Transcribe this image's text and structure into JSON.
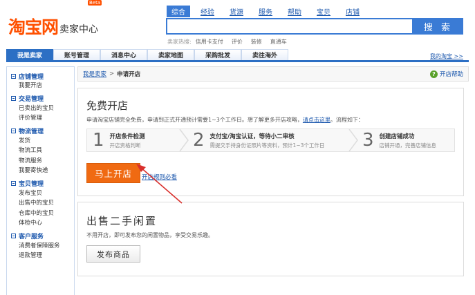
{
  "header": {
    "logo_main": "淘宝网",
    "logo_sub": "卖家中心",
    "logo_badge": "Beta",
    "search_tabs": [
      "综合",
      "经验",
      "货源",
      "服务",
      "帮助",
      "宝贝",
      "店铺"
    ],
    "search_button": "搜 索",
    "hot_label": "卖家热搜:",
    "hot_items": [
      "信用卡支付",
      "评价",
      "装修",
      "直通车"
    ]
  },
  "nav": {
    "items": [
      "我是卖家",
      "账号管理",
      "消息中心",
      "卖家地图",
      "采购批发",
      "卖往海外"
    ],
    "right_link": "我的淘宝 >>"
  },
  "sidebar": {
    "groups": [
      {
        "title": "店铺管理",
        "items": [
          "我要开店"
        ]
      },
      {
        "title": "交易管理",
        "items": [
          "已卖出的宝贝",
          "评价管理"
        ]
      },
      {
        "title": "物流管理",
        "items": [
          "发货",
          "物流工具",
          "物流服务",
          "我要寄快递"
        ]
      },
      {
        "title": "宝贝管理",
        "items": [
          "发布宝贝",
          "出售中的宝贝",
          "仓库中的宝贝",
          "体检中心"
        ]
      },
      {
        "title": "客户服务",
        "items": [
          "消费者保障服务",
          "退款管理"
        ]
      }
    ]
  },
  "breadcrumb": {
    "root": "我是卖家",
    "sep": ">",
    "current": "申请开店",
    "help": "开店帮助"
  },
  "open_shop": {
    "title": "免费开店",
    "desc_text": "申请淘宝店铺完全免费，申请到正式开通预计需要1~3个工作日。想了解更多开店攻略，",
    "desc_link": "请点击这里",
    "desc_tail": "。流程如下：",
    "steps": [
      {
        "num": "1",
        "title": "开店条件检测",
        "desc": "开店资格判断"
      },
      {
        "num": "2",
        "title": "支付宝/淘宝认证，等待小二审核",
        "desc": "需提交手持身份证照片等资料，预计1~3个工作日"
      },
      {
        "num": "3",
        "title": "创建店铺成功",
        "desc": "店铺开通，完善店铺信息"
      }
    ],
    "button": "马上开店",
    "rule_link": "开店规则必看"
  },
  "idle": {
    "title": "出售二手闲置",
    "desc": "不用开店，即可发布您的闲置物品，享受交易乐趣。",
    "button": "发布商品"
  },
  "colors": {
    "brand": "#ff5000",
    "primary_blue": "#2c6fc4",
    "link": "#1b57ad",
    "cta": "#f06a12",
    "annotation": "#d9302c"
  }
}
